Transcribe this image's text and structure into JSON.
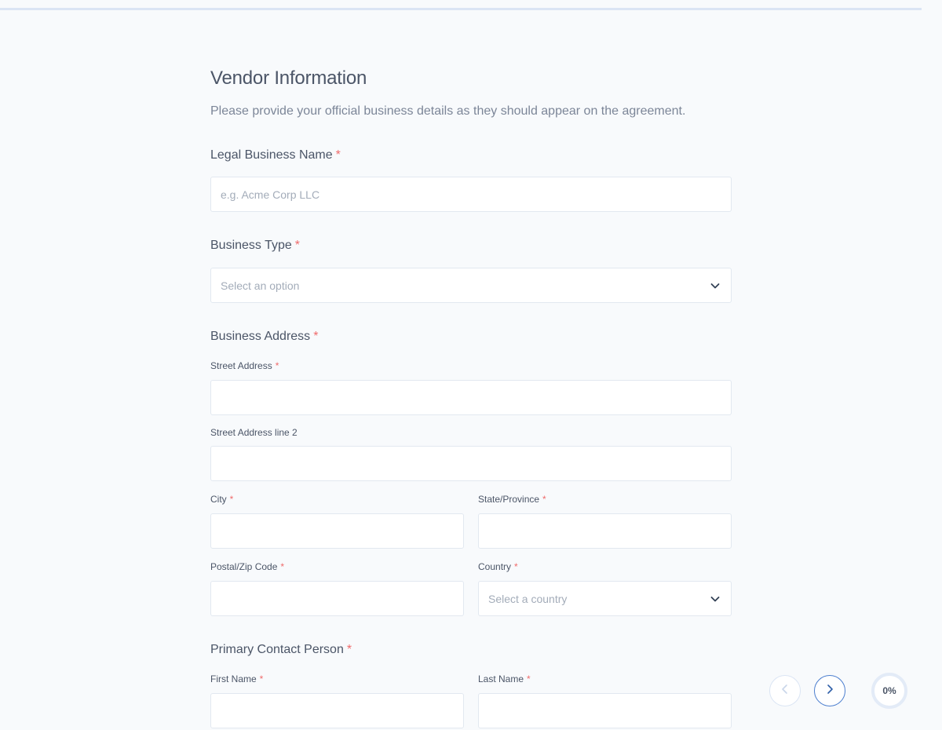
{
  "form": {
    "title": "Vendor Information",
    "subtitle": "Please provide your official business details as they should appear on the agreement.",
    "required_marker": "*",
    "legal_name": {
      "label": "Legal Business Name",
      "placeholder": "e.g. Acme Corp LLC",
      "value": ""
    },
    "business_type": {
      "label": "Business Type",
      "selected": "Select an option"
    },
    "address": {
      "label": "Business Address",
      "street": {
        "label": "Street Address",
        "value": ""
      },
      "street2": {
        "label": "Street Address line 2",
        "value": ""
      },
      "city": {
        "label": "City",
        "value": ""
      },
      "state": {
        "label": "State/Province",
        "value": ""
      },
      "postal": {
        "label": "Postal/Zip Code",
        "value": ""
      },
      "country": {
        "label": "Country",
        "selected": "Select a country"
      }
    },
    "contact": {
      "label": "Primary Contact Person",
      "first_name": {
        "label": "First Name",
        "value": ""
      },
      "last_name": {
        "label": "Last Name",
        "value": ""
      }
    }
  },
  "navigation": {
    "prev_icon": "chevron-left-icon",
    "next_icon": "chevron-right-icon",
    "progress_label": "0%",
    "progress_value": 0
  },
  "colors": {
    "background": "#f8fafc",
    "required": "#ef6b6b",
    "accent": "#4d7fcf",
    "top_bar": "#dbe5f4"
  }
}
